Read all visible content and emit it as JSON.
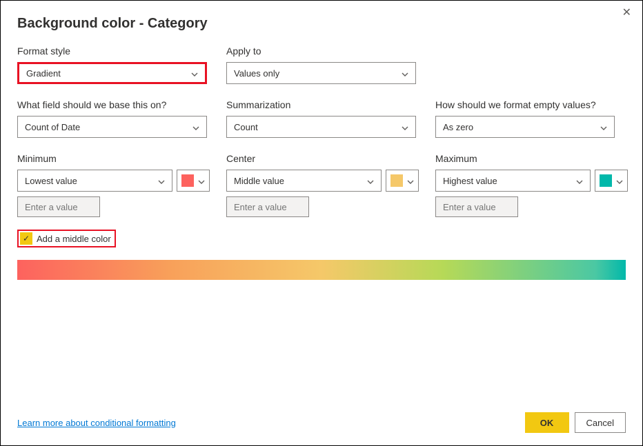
{
  "dialog": {
    "title": "Background color - Category",
    "close_glyph": "✕"
  },
  "format_style": {
    "label": "Format style",
    "value": "Gradient"
  },
  "apply_to": {
    "label": "Apply to",
    "value": "Values only"
  },
  "base_field": {
    "label": "What field should we base this on?",
    "value": "Count of Date"
  },
  "summarization": {
    "label": "Summarization",
    "value": "Count"
  },
  "empty_values": {
    "label": "How should we format empty values?",
    "value": "As zero"
  },
  "minimum": {
    "label": "Minimum",
    "value_mode": "Lowest value",
    "placeholder": "Enter a value",
    "color": "#fd625e"
  },
  "center": {
    "label": "Center",
    "value_mode": "Middle value",
    "placeholder": "Enter a value",
    "color": "#f5c869"
  },
  "maximum": {
    "label": "Maximum",
    "value_mode": "Highest value",
    "placeholder": "Enter a value",
    "color": "#01b8aa"
  },
  "middle_checkbox": {
    "label": "Add a middle color",
    "checked_glyph": "✓"
  },
  "footer": {
    "learn_more": "Learn more about conditional formatting",
    "ok": "OK",
    "cancel": "Cancel"
  }
}
